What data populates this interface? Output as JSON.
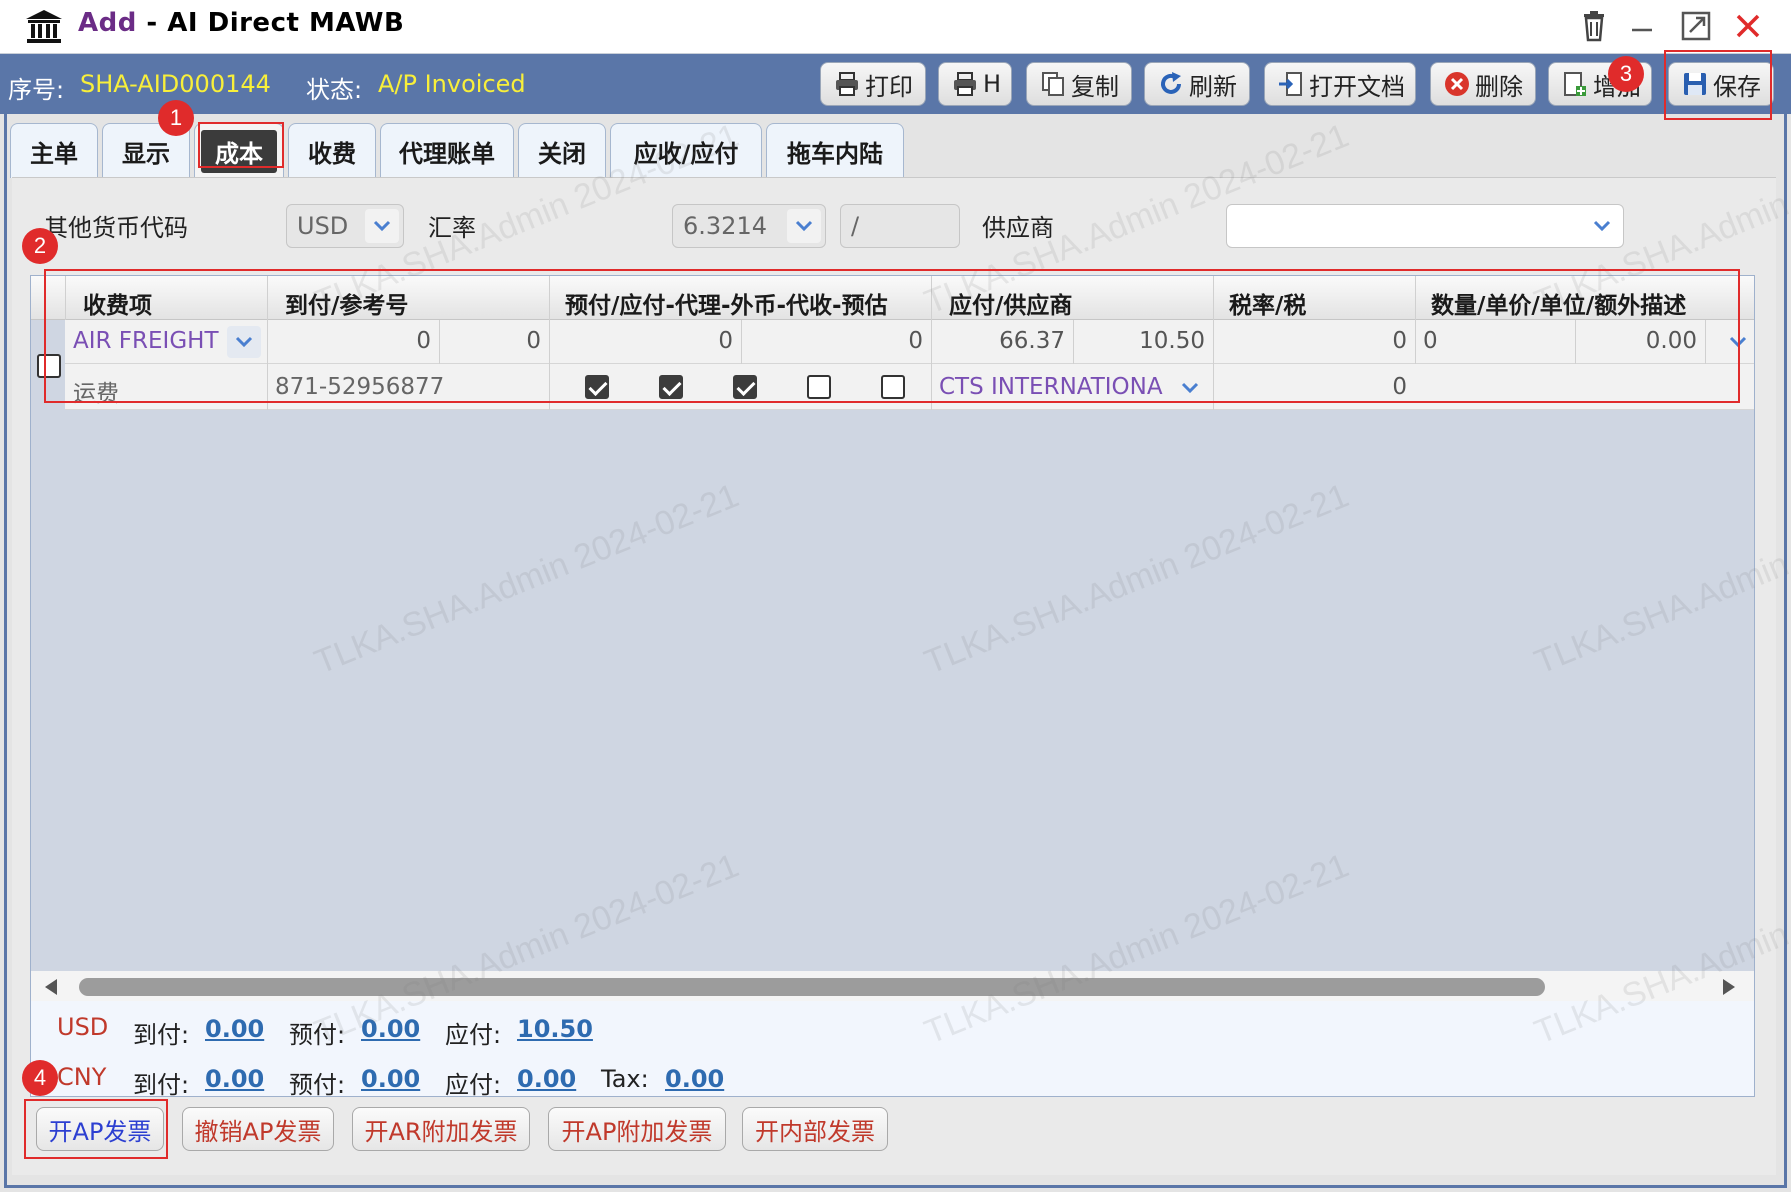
{
  "window": {
    "title_prefix": "Add",
    "title_sep": " - ",
    "title": "AI Direct MAWB"
  },
  "info": {
    "serial_label": "序号:",
    "serial_value": "SHA-AID000144",
    "status_label": "状态:",
    "status_value": "A/P Invoiced"
  },
  "toolbar": [
    {
      "label": "打印",
      "icon": "printer-icon"
    },
    {
      "label": "H",
      "icon": "printer-icon"
    },
    {
      "label": "复制",
      "icon": "copy-icon"
    },
    {
      "label": "刷新",
      "icon": "refresh-icon"
    },
    {
      "label": "打开文档",
      "icon": "open-document-icon"
    },
    {
      "label": "删除",
      "icon": "delete-icon"
    },
    {
      "label": "增加",
      "icon": "add-icon"
    },
    {
      "label": "保存",
      "icon": "save-icon"
    }
  ],
  "tabs": [
    "主单",
    "显示",
    "成本",
    "收费",
    "代理账单",
    "关闭",
    "应收/应付",
    "拖车内陆"
  ],
  "active_tab": "成本",
  "filters": {
    "currency_label": "其他货币代码",
    "currency_value": "USD",
    "rate_label": "汇率",
    "rate_value": "6.3214",
    "rate_extra": "/",
    "supplier_label": "供应商",
    "supplier_value": ""
  },
  "grid": {
    "headers": [
      "收费项",
      "到付/参考号",
      "预付/应付-代理-外币-代收-预估",
      "应付/供应商",
      "税率/税",
      "数量/单价/单位/额外描述"
    ],
    "row1": {
      "charge": "AIR FREIGHT",
      "collect_a": "0",
      "collect_b": "0",
      "prepaid_a": "0",
      "prepaid_b": "0",
      "payable": "66.37",
      "supplier_amount": "10.50",
      "tax_rate": "0",
      "quantity": "0",
      "unit_price": "0.00"
    },
    "row2": {
      "charge_desc": "运费",
      "reference": "871-52956877",
      "flags": [
        true,
        true,
        true,
        false,
        false
      ],
      "supplier": "CTS INTERNATIONA",
      "tax": "0"
    }
  },
  "totals": {
    "collect_label": "到付:",
    "prepaid_label": "预付:",
    "payable_label": "应付:",
    "tax_label": "Tax:",
    "usd": {
      "currency": "USD",
      "collect": "0.00",
      "prepaid": "0.00",
      "payable": "10.50"
    },
    "cny": {
      "currency": "CNY",
      "collect": "0.00",
      "prepaid": "0.00",
      "payable": "0.00",
      "tax": "0.00"
    }
  },
  "bottom_buttons": [
    "开AP发票",
    "撤销AP发票",
    "开AR附加发票",
    "开AP附加发票",
    "开内部发票"
  ],
  "annotations": [
    "1",
    "2",
    "3",
    "4"
  ],
  "watermark": "TLKA.SHA.Admin 2024-02-21",
  "colors": {
    "header_bar": "#5a76a8",
    "status_value": "#f8ef3a",
    "annotation_red": "#e02b2b",
    "link_blue": "#2e6bb0",
    "supplier_purple": "#7a4fb4"
  }
}
